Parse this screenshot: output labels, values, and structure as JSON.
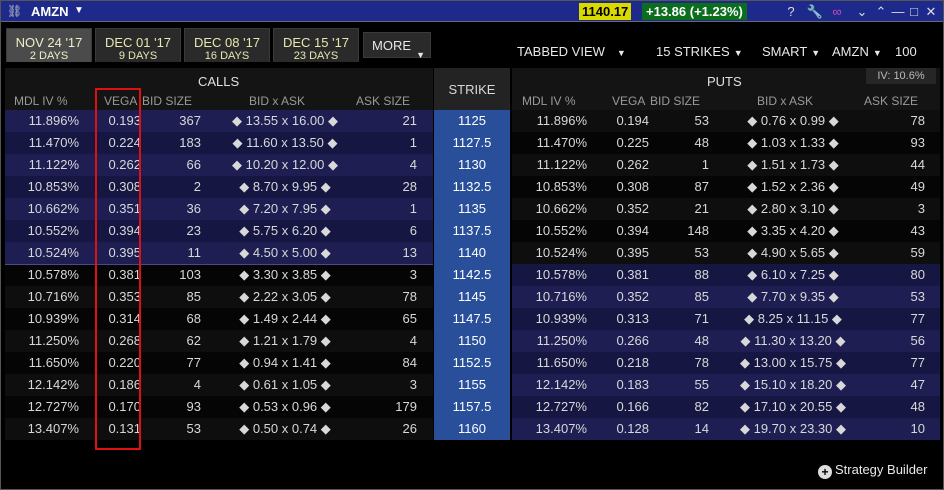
{
  "titlebar": {
    "link_icon": "link-icon",
    "symbol": "AMZN",
    "price": "1140.17",
    "change": "+13.86 (+1.23%)",
    "colors": {
      "bar": "#1d2a8c",
      "price_bg": "#d9d900",
      "change_bg": "#0b6e1e"
    }
  },
  "expirations": [
    {
      "date": "NOV 24 '17",
      "days": "2 DAYS",
      "active": true
    },
    {
      "date": "DEC 01 '17",
      "days": "9 DAYS",
      "active": false
    },
    {
      "date": "DEC 08 '17",
      "days": "16 DAYS",
      "active": false
    },
    {
      "date": "DEC 15 '17",
      "days": "23 DAYS",
      "active": false
    }
  ],
  "toolbar": {
    "more": "MORE",
    "view": "TABBED VIEW",
    "strikes": "15 STRIKES",
    "exchange": "SMART",
    "underlying": "AMZN",
    "multiplier": "100"
  },
  "headers": {
    "calls": "CALLS",
    "puts": "PUTS",
    "strike": "STRIKE",
    "iv": "IV: 10.6%",
    "columns": [
      "MDL IV %",
      "VEGA",
      "BID SIZE",
      "BID x ASK",
      "ASK SIZE"
    ]
  },
  "rows": [
    {
      "strike": "1125",
      "c_iv": "11.896%",
      "c_vega": "0.193",
      "c_bsize": "367",
      "c_bid": "13.55",
      "c_ask": "16.00",
      "c_asize": "21",
      "p_iv": "11.896%",
      "p_vega": "0.194",
      "p_bsize": "53",
      "p_bid": "0.76",
      "p_ask": "0.99",
      "p_asize": "78"
    },
    {
      "strike": "1127.5",
      "c_iv": "11.470%",
      "c_vega": "0.224",
      "c_bsize": "183",
      "c_bid": "11.60",
      "c_ask": "13.50",
      "c_asize": "1",
      "p_iv": "11.470%",
      "p_vega": "0.225",
      "p_bsize": "48",
      "p_bid": "1.03",
      "p_ask": "1.33",
      "p_asize": "93"
    },
    {
      "strike": "1130",
      "c_iv": "11.122%",
      "c_vega": "0.262",
      "c_bsize": "66",
      "c_bid": "10.20",
      "c_ask": "12.00",
      "c_asize": "4",
      "p_iv": "11.122%",
      "p_vega": "0.262",
      "p_bsize": "1",
      "p_bid": "1.51",
      "p_ask": "1.73",
      "p_asize": "44"
    },
    {
      "strike": "1132.5",
      "c_iv": "10.853%",
      "c_vega": "0.308",
      "c_bsize": "2",
      "c_bid": "8.70",
      "c_ask": "9.95",
      "c_asize": "28",
      "p_iv": "10.853%",
      "p_vega": "0.308",
      "p_bsize": "87",
      "p_bid": "1.52",
      "p_ask": "2.36",
      "p_asize": "49"
    },
    {
      "strike": "1135",
      "c_iv": "10.662%",
      "c_vega": "0.351",
      "c_bsize": "36",
      "c_bid": "7.20",
      "c_ask": "7.95",
      "c_asize": "1",
      "p_iv": "10.662%",
      "p_vega": "0.352",
      "p_bsize": "21",
      "p_bid": "2.80",
      "p_ask": "3.10",
      "p_asize": "3"
    },
    {
      "strike": "1137.5",
      "c_iv": "10.552%",
      "c_vega": "0.394",
      "c_bsize": "23",
      "c_bid": "5.75",
      "c_ask": "6.20",
      "c_asize": "6",
      "p_iv": "10.552%",
      "p_vega": "0.394",
      "p_bsize": "148",
      "p_bid": "3.35",
      "p_ask": "4.20",
      "p_asize": "43"
    },
    {
      "strike": "1140",
      "c_iv": "10.524%",
      "c_vega": "0.395",
      "c_bsize": "11",
      "c_bid": "4.50",
      "c_ask": "5.00",
      "c_asize": "13",
      "p_iv": "10.524%",
      "p_vega": "0.395",
      "p_bsize": "53",
      "p_bid": "4.90",
      "p_ask": "5.65",
      "p_asize": "59"
    },
    {
      "strike": "1142.5",
      "c_iv": "10.578%",
      "c_vega": "0.381",
      "c_bsize": "103",
      "c_bid": "3.30",
      "c_ask": "3.85",
      "c_asize": "3",
      "p_iv": "10.578%",
      "p_vega": "0.381",
      "p_bsize": "88",
      "p_bid": "6.10",
      "p_ask": "7.25",
      "p_asize": "80"
    },
    {
      "strike": "1145",
      "c_iv": "10.716%",
      "c_vega": "0.353",
      "c_bsize": "85",
      "c_bid": "2.22",
      "c_ask": "3.05",
      "c_asize": "78",
      "p_iv": "10.716%",
      "p_vega": "0.352",
      "p_bsize": "85",
      "p_bid": "7.70",
      "p_ask": "9.35",
      "p_asize": "53"
    },
    {
      "strike": "1147.5",
      "c_iv": "10.939%",
      "c_vega": "0.314",
      "c_bsize": "68",
      "c_bid": "1.49",
      "c_ask": "2.44",
      "c_asize": "65",
      "p_iv": "10.939%",
      "p_vega": "0.313",
      "p_bsize": "71",
      "p_bid": "8.25",
      "p_ask": "11.15",
      "p_asize": "77"
    },
    {
      "strike": "1150",
      "c_iv": "11.250%",
      "c_vega": "0.268",
      "c_bsize": "62",
      "c_bid": "1.21",
      "c_ask": "1.79",
      "c_asize": "4",
      "p_iv": "11.250%",
      "p_vega": "0.266",
      "p_bsize": "48",
      "p_bid": "11.30",
      "p_ask": "13.20",
      "p_asize": "56"
    },
    {
      "strike": "1152.5",
      "c_iv": "11.650%",
      "c_vega": "0.220",
      "c_bsize": "77",
      "c_bid": "0.94",
      "c_ask": "1.41",
      "c_asize": "84",
      "p_iv": "11.650%",
      "p_vega": "0.218",
      "p_bsize": "78",
      "p_bid": "13.00",
      "p_ask": "15.75",
      "p_asize": "77"
    },
    {
      "strike": "1155",
      "c_iv": "12.142%",
      "c_vega": "0.186",
      "c_bsize": "4",
      "c_bid": "0.61",
      "c_ask": "1.05",
      "c_asize": "3",
      "p_iv": "12.142%",
      "p_vega": "0.183",
      "p_bsize": "55",
      "p_bid": "15.10",
      "p_ask": "18.20",
      "p_asize": "47"
    },
    {
      "strike": "1157.5",
      "c_iv": "12.727%",
      "c_vega": "0.170",
      "c_bsize": "93",
      "c_bid": "0.53",
      "c_ask": "0.96",
      "c_asize": "179",
      "p_iv": "12.727%",
      "p_vega": "0.166",
      "p_bsize": "82",
      "p_bid": "17.10",
      "p_ask": "20.55",
      "p_asize": "48"
    },
    {
      "strike": "1160",
      "c_iv": "13.407%",
      "c_vega": "0.131",
      "c_bsize": "53",
      "c_bid": "0.50",
      "c_ask": "0.74",
      "c_asize": "26",
      "p_iv": "13.407%",
      "p_vega": "0.128",
      "p_bsize": "14",
      "p_bid": "19.70",
      "p_ask": "23.30",
      "p_asize": "10"
    }
  ],
  "bid_ask_separator": "x",
  "diamond": "◆",
  "strategy_builder": "Strategy Builder",
  "row_colors": {
    "itm_calls_a": "#1e1e52",
    "itm_calls_b": "#161642",
    "otm_a": "#0e0e0e",
    "otm_b": "#050505",
    "itm_puts_a": "#1e1e52",
    "itm_puts_b": "#161642",
    "strike_bg": "#2a4f9a"
  }
}
